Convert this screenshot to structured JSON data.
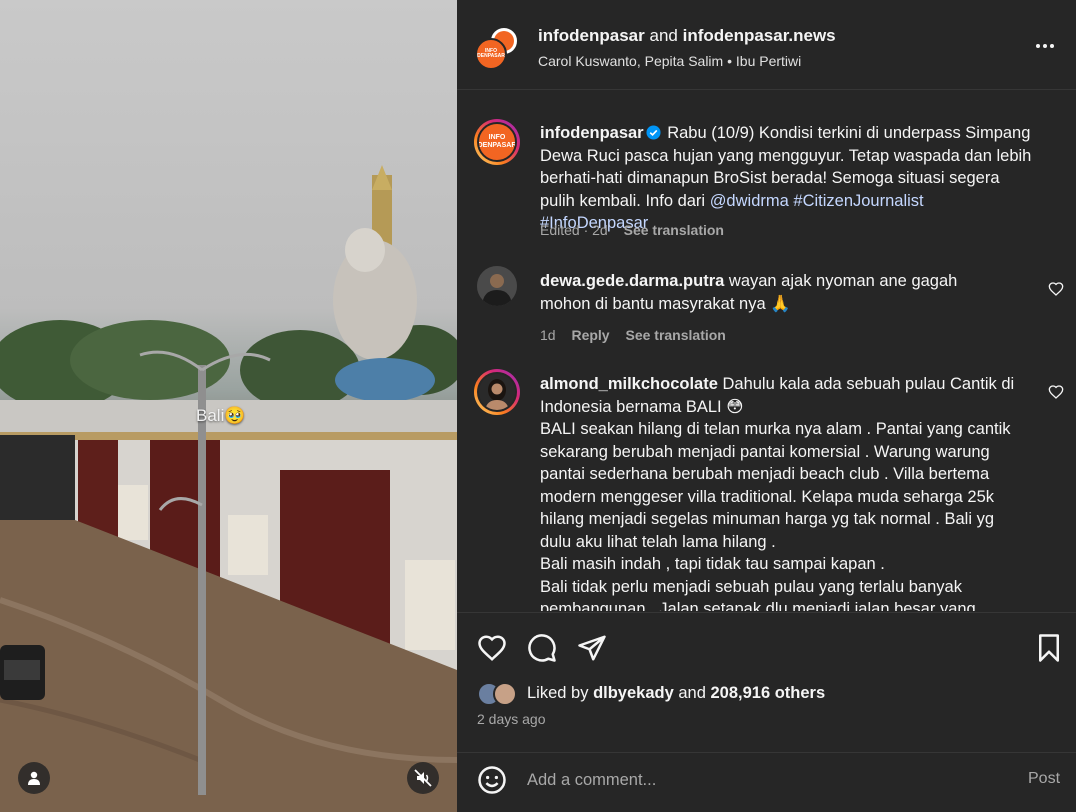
{
  "media": {
    "overlay_text": "Bali🥹",
    "user_button_icon": "user-icon",
    "mute_button_icon": "speaker-muted-icon"
  },
  "header": {
    "account_1": "infodenpasar",
    "joiner": "and",
    "account_2": "infodenpasar.news",
    "collaborators": "Carol Kuswanto, Pepita Salim",
    "separator": "•",
    "audio": "Ibu Pertiwi",
    "avatar_text_1": "INFO",
    "avatar_text_2": "DENPASAR",
    "more_icon": "more-horizontal-icon"
  },
  "caption": {
    "username": "infodenpasar",
    "text": "Rabu (10/9) Kondisi terkini di underpass Simpang Dewa Ruci pasca hujan yang mengguyur. Tetap waspada dan lebih berhati-hati dimanapun BroSist berada! Semoga situasi segera pulih kembali. Info dari",
    "links": [
      "@dwidrma",
      "#CitizenJournalist",
      "#InfoDenpasar"
    ],
    "edited": "Edited · 2d",
    "see_translation": "See translation"
  },
  "comments": [
    {
      "username": "dewa.gede.darma.putra",
      "text": "wayan ajak nyoman ane gagah",
      "text_line2": "mohon di bantu masyrakat nya 🙏",
      "time": "1d",
      "reply": "Reply",
      "see_translation": "See translation"
    },
    {
      "username": "almond_milkchocolate",
      "lines": [
        "Dahulu kala ada sebuah pulau Cantik di",
        "Indonesia bernama BALI 😳",
        "BALI seakan hilang di telan murka nya alam . Pantai yang cantik",
        "sekarang berubah menjadi pantai komersial . Warung warung",
        "pantai sederhana berubah menjadi beach club . Villa bertema",
        "modern menggeser villa traditional. Kelapa muda seharga 25k",
        "hilang menjadi segelas minuman harga yg tak normal . Bali yg",
        "dulu aku lihat telah lama hilang .",
        "Bali masih indah , tapi tidak tau sampai kapan .",
        "Bali tidak perlu menjadi sebuah pulau yang terlalu banyak",
        "pembangunan . Jalan setapak dlu menjadi jalan besar yang"
      ]
    }
  ],
  "actions": {
    "like_icon": "heart-icon",
    "comment_icon": "comment-icon",
    "share_icon": "share-icon",
    "save_icon": "bookmark-icon"
  },
  "likes": {
    "prefix": "Liked by",
    "user": "dlbyekady",
    "joiner": "and",
    "count": "208,916 others"
  },
  "posted": "2 days ago",
  "composer": {
    "emoji_icon": "emoji-icon",
    "placeholder": "Add a comment...",
    "post_label": "Post"
  },
  "colors": {
    "panel_bg": "#262626",
    "link": "#c4d7ff",
    "muted": "#a8a8a8",
    "brand_orange": "#f26522",
    "verified": "#0095f6"
  }
}
